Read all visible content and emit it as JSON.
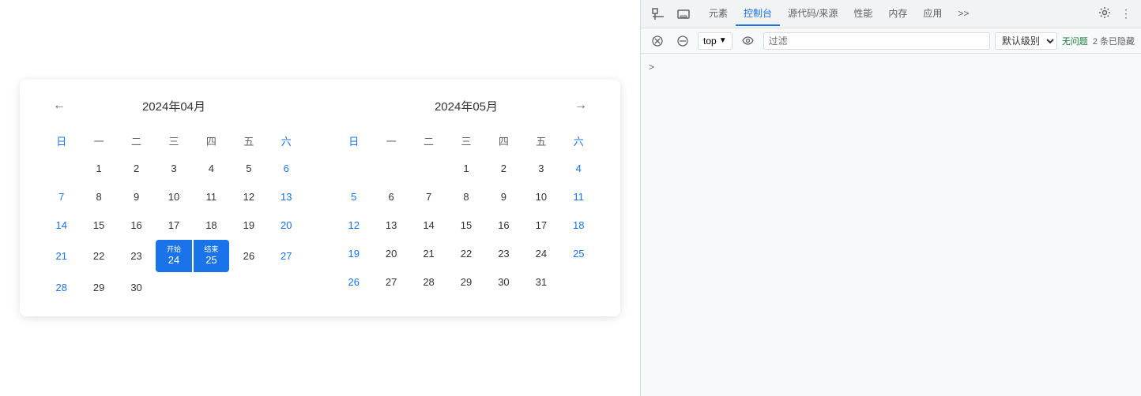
{
  "calendar": {
    "prev_btn": "←",
    "next_btn": "→",
    "april": {
      "title": "2024年04月",
      "weekdays": [
        "日",
        "一",
        "二",
        "三",
        "四",
        "五",
        "六"
      ],
      "weeks": [
        [
          null,
          1,
          2,
          3,
          4,
          5,
          6
        ],
        [
          7,
          8,
          9,
          10,
          11,
          12,
          13
        ],
        [
          14,
          15,
          16,
          17,
          18,
          19,
          20
        ],
        [
          21,
          22,
          23,
          24,
          25,
          26,
          27
        ],
        [
          28,
          29,
          30,
          null,
          null,
          null,
          null
        ]
      ],
      "selected_start": 24,
      "selected_end": 25,
      "start_label": "开始",
      "end_label": "结束"
    },
    "may": {
      "title": "2024年05月",
      "weeks": [
        [
          null,
          null,
          null,
          1,
          2,
          3,
          4
        ],
        [
          5,
          6,
          7,
          8,
          9,
          10,
          11
        ],
        [
          12,
          13,
          14,
          15,
          16,
          17,
          18
        ],
        [
          19,
          20,
          21,
          22,
          23,
          24,
          25
        ],
        [
          26,
          27,
          28,
          29,
          30,
          31,
          null
        ]
      ]
    }
  },
  "devtools": {
    "toolbar_icons": {
      "inspect": "⊡",
      "device": "▭",
      "gear": "⚙",
      "more": "⋮"
    },
    "tabs": [
      "元素",
      "控制台",
      "源代码/来源",
      "性能",
      "内存",
      "应用",
      ">>"
    ],
    "active_tab": "控制台",
    "top_label": "top",
    "eye_icon": "👁",
    "filter_placeholder": "过滤",
    "level_label": "默认级别",
    "no_issues": "无问题",
    "hidden_count": "2 条已隐藏",
    "expand_icon": ">"
  }
}
